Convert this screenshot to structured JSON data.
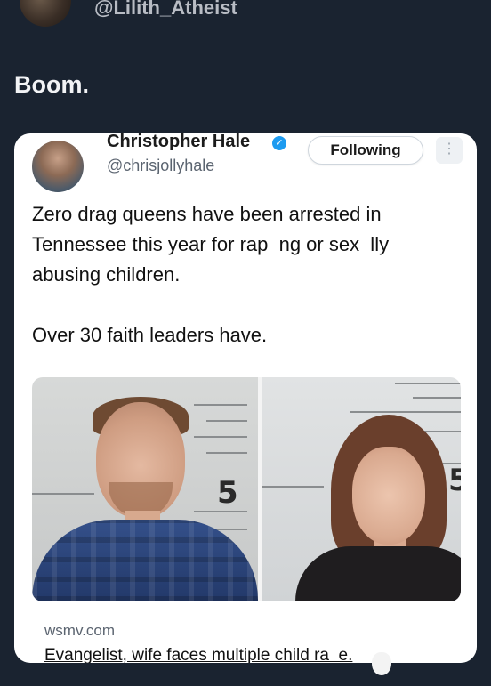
{
  "header": {
    "handle": "@Lilith_Atheist"
  },
  "post": {
    "text": "Boom."
  },
  "quoted_tweet": {
    "author_name": "Christopher Hale",
    "author_handle": "@chrisjollyhale",
    "follow_label": "Following",
    "body": "Zero drag queens have been arrested in Tennessee this year for rap  ng or sex  lly abusing children.\n\nOver 30 faith leaders have.",
    "image": {
      "ruler_mark_left": "5",
      "ruler_mark_right": "5"
    },
    "link": {
      "domain": "wsmv.com",
      "title": "Evangelist, wife faces multiple child ra  e."
    }
  },
  "icons": {
    "verified": "verified-badge-icon",
    "more": "more-options-icon"
  },
  "colors": {
    "background": "#1a2330",
    "card": "#ffffff",
    "verified_blue": "#1d9bf0"
  }
}
